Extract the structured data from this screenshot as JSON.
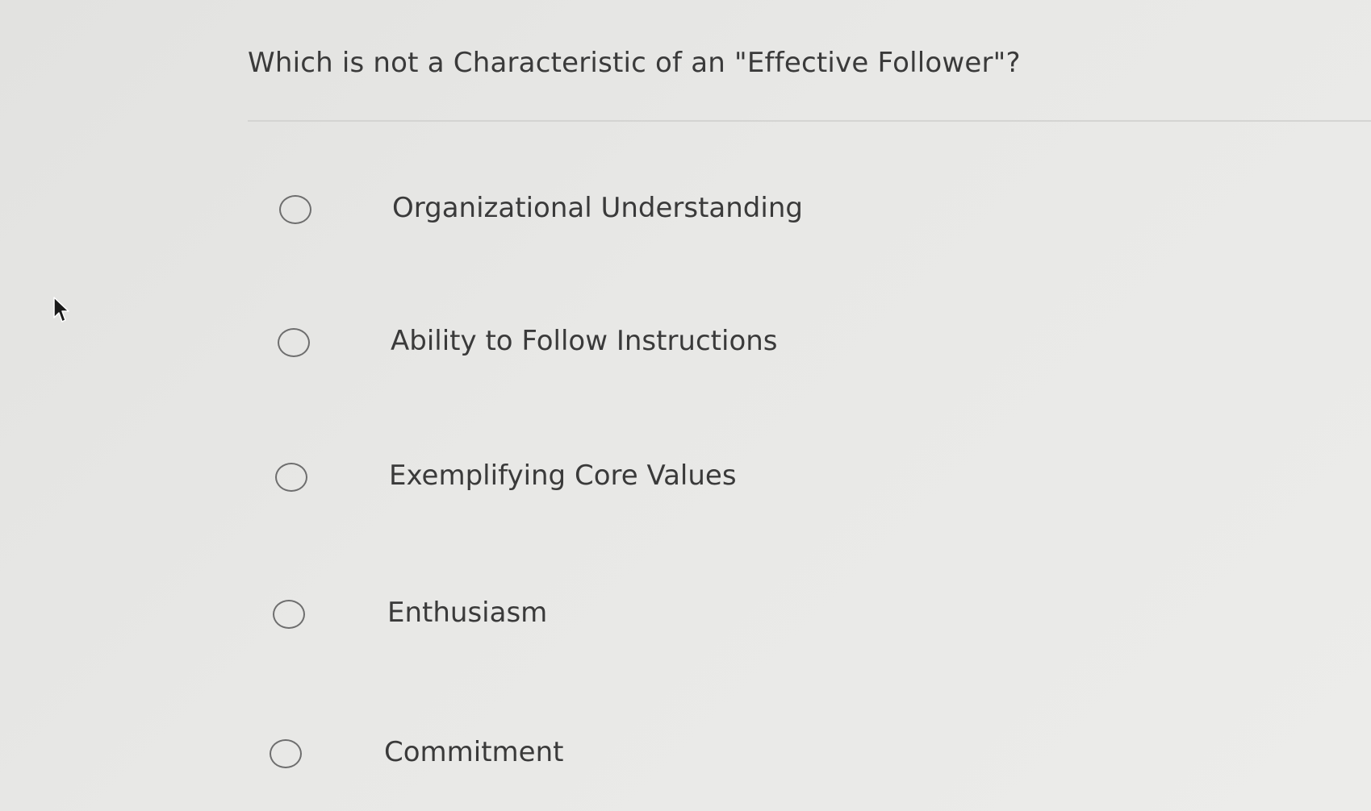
{
  "question": {
    "text": "Which is not a Characteristic of an \"Effective Follower\"?"
  },
  "options": [
    {
      "label": "Organizational Understanding",
      "selected": false
    },
    {
      "label": "Ability to Follow Instructions",
      "selected": false
    },
    {
      "label": "Exemplifying Core Values",
      "selected": false
    },
    {
      "label": "Enthusiasm",
      "selected": false
    },
    {
      "label": "Commitment",
      "selected": false
    }
  ],
  "cursor": {
    "icon": "mouse-pointer-icon"
  }
}
